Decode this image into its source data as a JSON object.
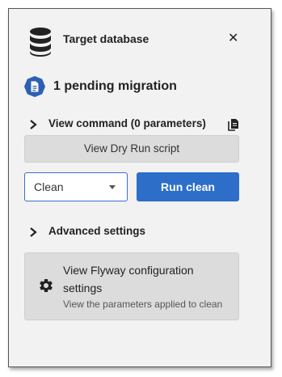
{
  "header": {
    "title": "Target database",
    "close_icon": "close-icon",
    "db_icon": "database-icon"
  },
  "pending": {
    "text": "1 pending migration",
    "icon": "document-badge-icon"
  },
  "view_command": {
    "label": "View command (0 parameters)",
    "copy_icon": "copy-icon"
  },
  "dry_run": {
    "label": "View Dry Run script"
  },
  "action": {
    "selected": "Clean",
    "run_label": "Run clean"
  },
  "advanced": {
    "label": "Advanced settings"
  },
  "config": {
    "title": "View Flyway configuration settings",
    "subtitle": "View the parameters applied to clean",
    "icon": "gear-icon"
  },
  "colors": {
    "accent": "#2d6ec9",
    "badge": "#2e5fb5",
    "panel": "#f2f2f2",
    "button_gray": "#dcdcdc"
  }
}
